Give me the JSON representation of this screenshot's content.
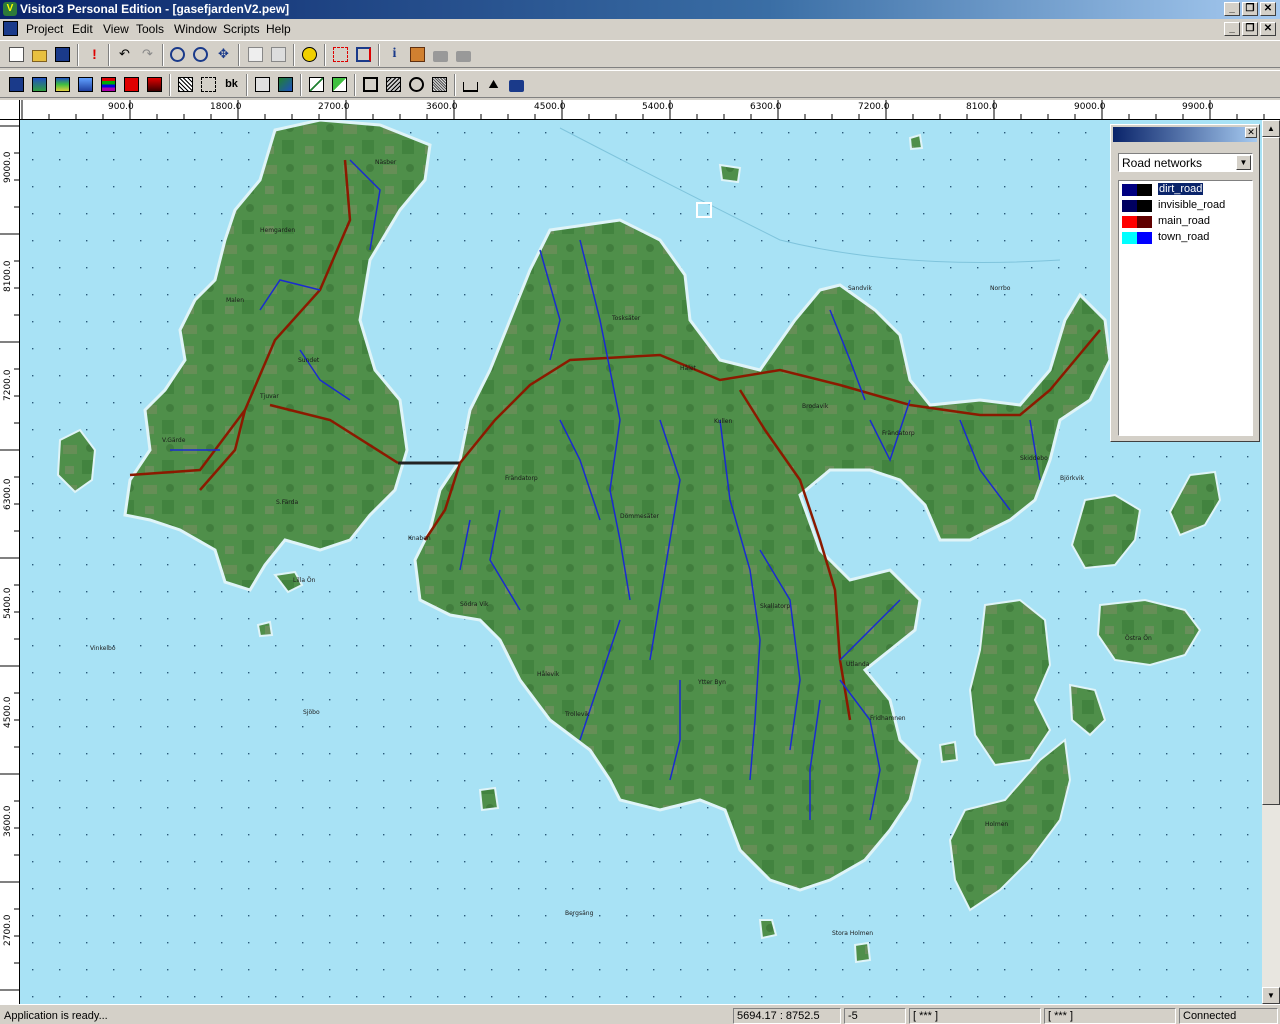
{
  "window": {
    "title": "Visitor3 Personal Edition - [gasefjardenV2.pew]",
    "app_icon": "V"
  },
  "menu": [
    "Project",
    "Edit",
    "View",
    "Tools",
    "Window",
    "Scripts",
    "Help"
  ],
  "toolbar1": [
    "new-file-icon",
    "open-folder-icon",
    "save-icon",
    "exclamation-icon",
    "undo-icon",
    "redo-icon",
    "zoom-in-icon",
    "zoom-out-icon",
    "pan-icon",
    "properties-icon",
    "delete-icon",
    "radiation-icon",
    "select-icon",
    "layer-icon",
    "info-icon",
    "edit-icon",
    "lock-icon",
    "unlock-icon"
  ],
  "toolbar2": [
    "layer-blue-icon",
    "layer-terrain-icon",
    "layer-landscape-icon",
    "layer-water-icon",
    "layer-bands-icon",
    "layer-red-icon",
    "layer-darkred-icon",
    "hatch-icon",
    "marquee-icon",
    "bk-label",
    "map-icon",
    "terrain-icon",
    "line-graph-icon",
    "diagonal-icon",
    "rect-icon",
    "pattern-icon",
    "circle-icon",
    "texture-icon",
    "ruler-icon",
    "profile-icon",
    "lock-tool-icon"
  ],
  "toolbar2_bk": "bk",
  "ruler_top": [
    "900.0",
    "1800.0",
    "2700.0",
    "3600.0",
    "4500.0",
    "5400.0",
    "6300.0",
    "7200.0",
    "8100.0",
    "9000.0",
    "9900.0"
  ],
  "ruler_left": [
    "9000.0",
    "8100.0",
    "7200.0",
    "6300.0",
    "5400.0",
    "4500.0",
    "3600.0",
    "2700.0"
  ],
  "legend": {
    "selected": "Road networks",
    "items": [
      {
        "label": "dirt_road",
        "colors": [
          "#000080",
          "#000000"
        ]
      },
      {
        "label": "invisible_road",
        "colors": [
          "#000060",
          "#000000"
        ]
      },
      {
        "label": "main_road",
        "colors": [
          "#ff0000",
          "#600000"
        ]
      },
      {
        "label": "town_road",
        "colors": [
          "#00ffff",
          "#0000ff"
        ]
      }
    ]
  },
  "map_labels": [
    "Näsber",
    "Hemgarden",
    "Malen",
    "Sundet",
    "Tjuvar",
    "V.Gärde",
    "S.Färda",
    "Tosksäter",
    "Hålet",
    "Kullen",
    "Brodavik",
    "Frändatorp",
    "Frändatorp",
    "Dömmesäter",
    "Skallatorp",
    "Utlanda",
    "Hålevik",
    "Ytter Byn",
    "Fridhamnen",
    "Skiddebo",
    "Knaben",
    "Trollevik",
    "Södra Vik",
    "Vinkelbo",
    "Östra Ön",
    "Holmen",
    "Sandvik",
    "Bergsäng",
    "Lilla Ön",
    "Norrbo",
    "Björkvik",
    "Sjöbo",
    "Stora Holmen"
  ],
  "status": {
    "message": "Application is ready...",
    "coords": "5694.17 : 8752.5",
    "value": "-5",
    "field1": "[ *** ]",
    "field2": "[ *** ]",
    "connection": "Connected"
  },
  "colors": {
    "sea": "#a8e2f5",
    "land": "#4f8f4a",
    "land_dark": "#3f7f3c",
    "land_light": "#6e8f5e",
    "main_road": "#8b1a00",
    "dirt_road": "#1a2bd0",
    "coast": "#dff4f8"
  }
}
